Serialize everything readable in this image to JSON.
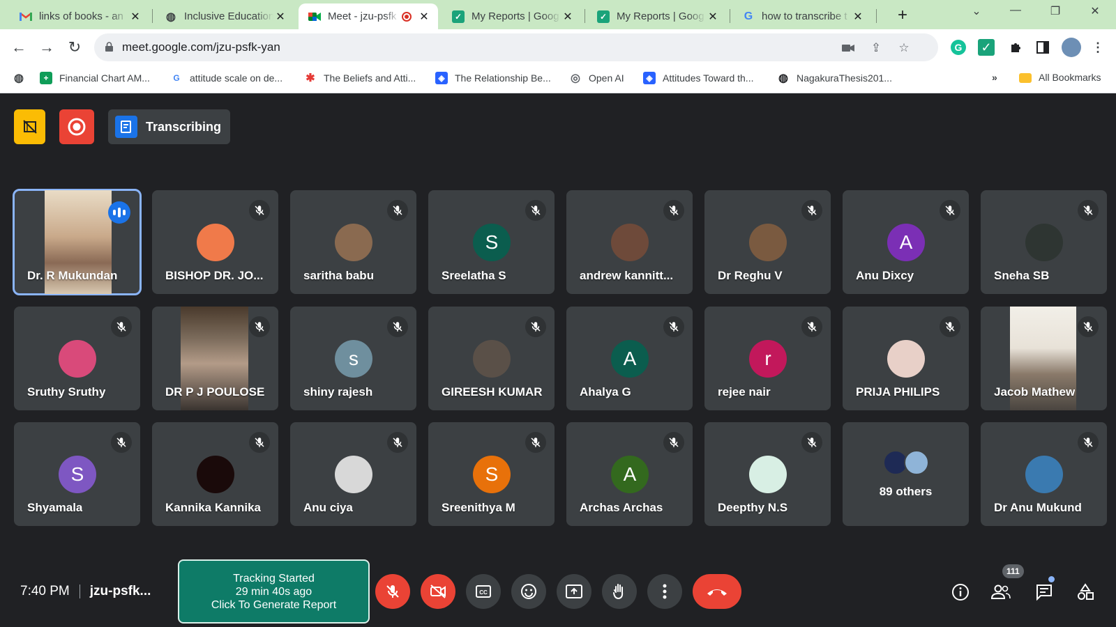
{
  "browser": {
    "tabs": [
      {
        "title": "links of books - an",
        "favicon": "gmail-icon"
      },
      {
        "title": "Inclusive Education",
        "favicon": "globe-icon"
      },
      {
        "title": "Meet - jzu-psfk",
        "favicon": "meet-icon",
        "active": true
      },
      {
        "title": "My Reports | Goog",
        "favicon": "check-icon"
      },
      {
        "title": "My Reports | Goog",
        "favicon": "check-icon"
      },
      {
        "title": "how to transcribe t",
        "favicon": "google-icon"
      }
    ],
    "url": "meet.google.com/jzu-psfk-yan",
    "bookmarks": [
      {
        "label": "Financial Chart AM..."
      },
      {
        "label": "attitude scale on de..."
      },
      {
        "label": "The Beliefs and Atti..."
      },
      {
        "label": "The Relationship Be..."
      },
      {
        "label": "Open AI"
      },
      {
        "label": "Attitudes Toward th..."
      },
      {
        "label": "NagakuraThesis201..."
      }
    ],
    "bookmarks_overflow": "»",
    "all_bookmarks": "All Bookmarks"
  },
  "meet": {
    "transcribing_label": "Transcribing",
    "participants": [
      {
        "name": "Dr. R Mukundan",
        "type": "video",
        "speaking": true
      },
      {
        "name": "BISHOP DR. JO...",
        "type": "photo",
        "color": "#f07a4a"
      },
      {
        "name": "saritha babu",
        "type": "photo",
        "color": "#8a6a50"
      },
      {
        "name": "Sreelatha S",
        "type": "letter",
        "letter": "S",
        "color": "#0b5d4e"
      },
      {
        "name": "andrew kannitt...",
        "type": "photo",
        "color": "#6e4a3a"
      },
      {
        "name": "Dr Reghu V",
        "type": "photo",
        "color": "#7a5a40"
      },
      {
        "name": "Anu Dixcy",
        "type": "letter",
        "letter": "A",
        "color": "#7b2fb5"
      },
      {
        "name": "Sneha SB",
        "type": "photo",
        "color": "#2e3532"
      },
      {
        "name": "Sruthy Sruthy",
        "type": "photo",
        "color": "#d94a7a"
      },
      {
        "name": "DR P J POULOSE",
        "type": "video"
      },
      {
        "name": "shiny rajesh",
        "type": "letter",
        "letter": "s",
        "color": "#6f8f9e"
      },
      {
        "name": "GIREESH KUMAR",
        "type": "photo",
        "color": "#5a5048"
      },
      {
        "name": "Ahalya G",
        "type": "letter",
        "letter": "A",
        "color": "#0b5d4e"
      },
      {
        "name": "rejee nair",
        "type": "letter",
        "letter": "r",
        "color": "#c2185b"
      },
      {
        "name": "PRIJA PHILIPS",
        "type": "photo",
        "color": "#e8d0c8"
      },
      {
        "name": "Jacob Mathew",
        "type": "video"
      },
      {
        "name": "Shyamala",
        "type": "letter",
        "letter": "S",
        "color": "#7e57c2"
      },
      {
        "name": "Kannika Kannika",
        "type": "photo",
        "color": "#1a0a0a"
      },
      {
        "name": "Anu ciya",
        "type": "photo",
        "color": "#d8d8d8"
      },
      {
        "name": "Sreenithya M",
        "type": "letter",
        "letter": "S",
        "color": "#e8710a"
      },
      {
        "name": "Archas Archas",
        "type": "letter",
        "letter": "A",
        "color": "#33691e"
      },
      {
        "name": "Deepthy N.S",
        "type": "photo",
        "color": "#d8efe4"
      },
      {
        "name": "89 others",
        "type": "others"
      },
      {
        "name": "Dr Anu Mukund",
        "type": "photo",
        "color": "#3a7ab0"
      }
    ],
    "time": "7:40 PM",
    "meeting_code": "jzu-psfk...",
    "tracking": {
      "line1": "Tracking Started",
      "line2": "29 min 40s ago",
      "line3": "Click To Generate Report"
    },
    "people_count": "111"
  }
}
